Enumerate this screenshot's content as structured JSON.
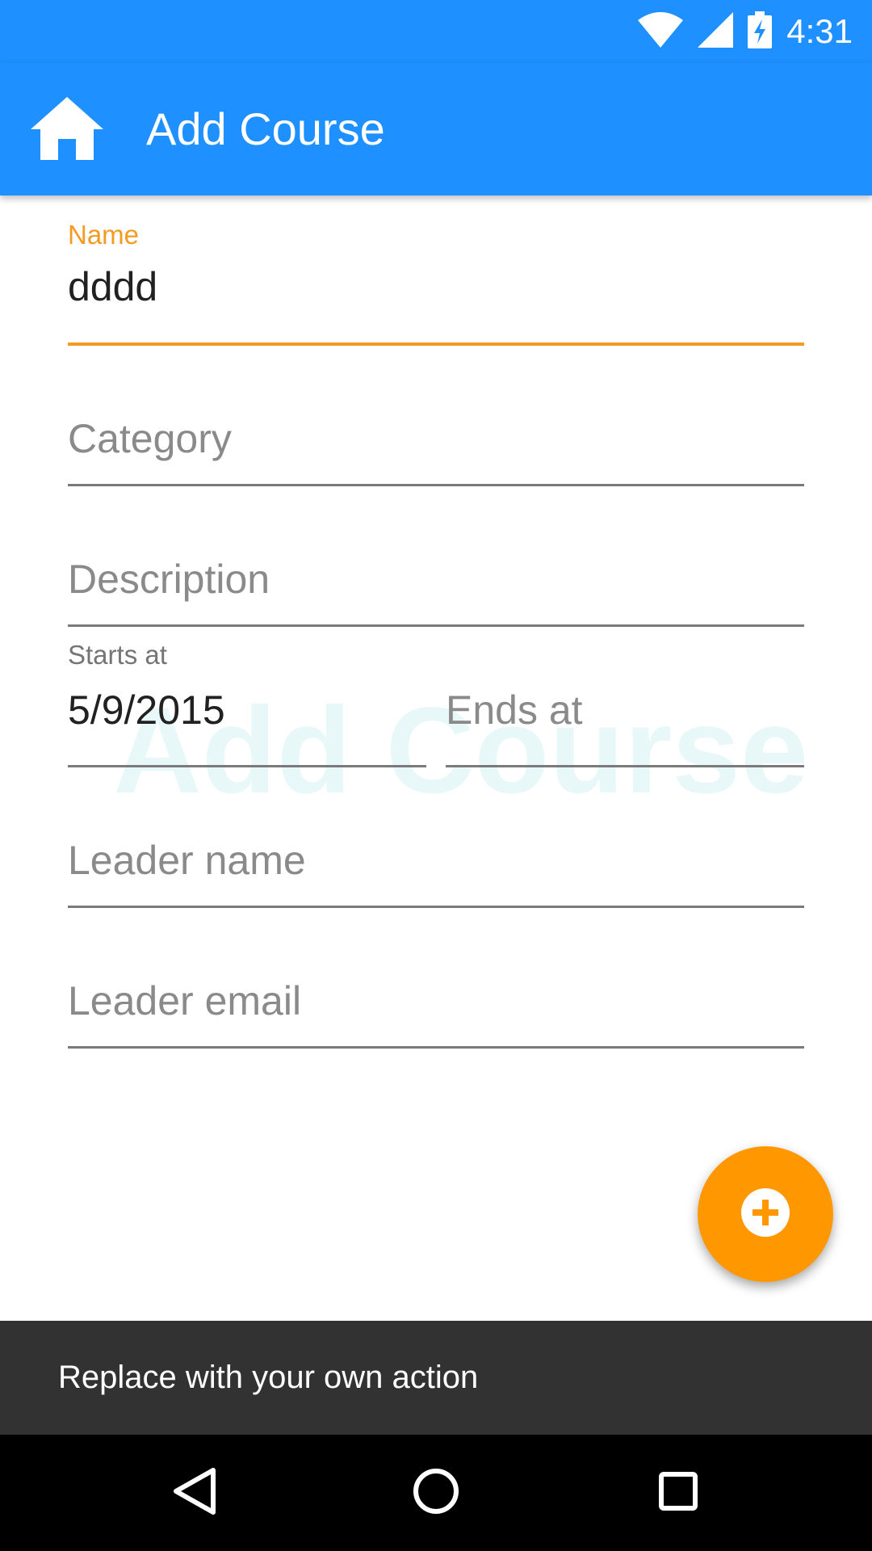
{
  "status_bar": {
    "time": "4:31",
    "icons": [
      "wifi-icon",
      "cell-signal-icon",
      "battery-charging-icon"
    ]
  },
  "app_bar": {
    "title": "Add Course",
    "home_icon": "home-icon",
    "color": "#1e90ff"
  },
  "watermark": "Add Course",
  "form": {
    "name": {
      "label": "Name",
      "value": "dddd"
    },
    "category": {
      "hint": "Category"
    },
    "description": {
      "hint": "Description"
    },
    "starts_at": {
      "label": "Starts at",
      "value": "5/9/2015"
    },
    "ends_at": {
      "hint": "Ends at"
    },
    "leader_name": {
      "hint": "Leader name"
    },
    "leader_email": {
      "hint": "Leader email"
    }
  },
  "fab": {
    "icon": "add-circle-icon",
    "color": "#ff9800"
  },
  "snackbar": {
    "text": "Replace with your own action"
  },
  "nav_bar": {
    "icons": [
      "back-icon",
      "home-circle-icon",
      "recents-icon"
    ]
  },
  "colors": {
    "accent": "#f59a23",
    "primary": "#1e90ff"
  }
}
